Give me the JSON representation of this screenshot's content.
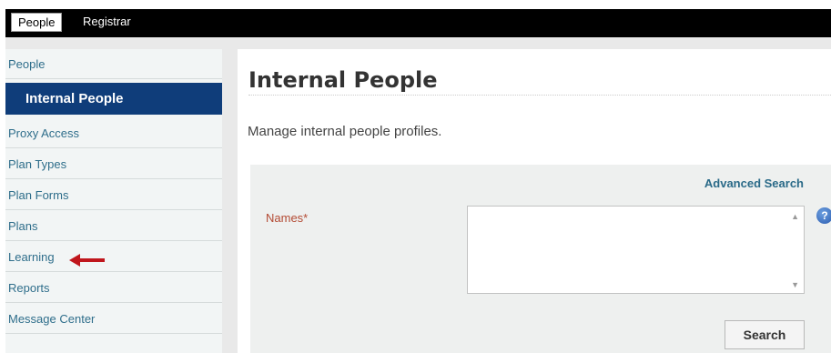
{
  "top_nav": {
    "tabs": [
      {
        "label": "People",
        "active": true
      },
      {
        "label": "Registrar",
        "active": false
      }
    ]
  },
  "sidebar": {
    "items": [
      {
        "label": "People",
        "active": false
      },
      {
        "label": "Internal People",
        "active": true
      },
      {
        "label": "Proxy Access",
        "active": false
      },
      {
        "label": "Plan Types",
        "active": false
      },
      {
        "label": "Plan Forms",
        "active": false
      },
      {
        "label": "Plans",
        "active": false
      },
      {
        "label": "Learning",
        "active": false,
        "annotated_with_arrow": true
      },
      {
        "label": "Reports",
        "active": false
      },
      {
        "label": "Message Center",
        "active": false
      }
    ]
  },
  "main": {
    "title": "Internal People",
    "subtitle": "Manage internal people profiles.",
    "advanced_search_label": "Advanced Search",
    "names_label": "Names*",
    "names_value": "",
    "search_button_label": "Search"
  },
  "colors": {
    "active_nav": "#0f3d7a",
    "link": "#2f6e8b",
    "required_label": "#b34a33",
    "arrow": "#c0161c"
  },
  "icons": {
    "help": "help-icon",
    "arrow": "red-arrow-icon"
  }
}
